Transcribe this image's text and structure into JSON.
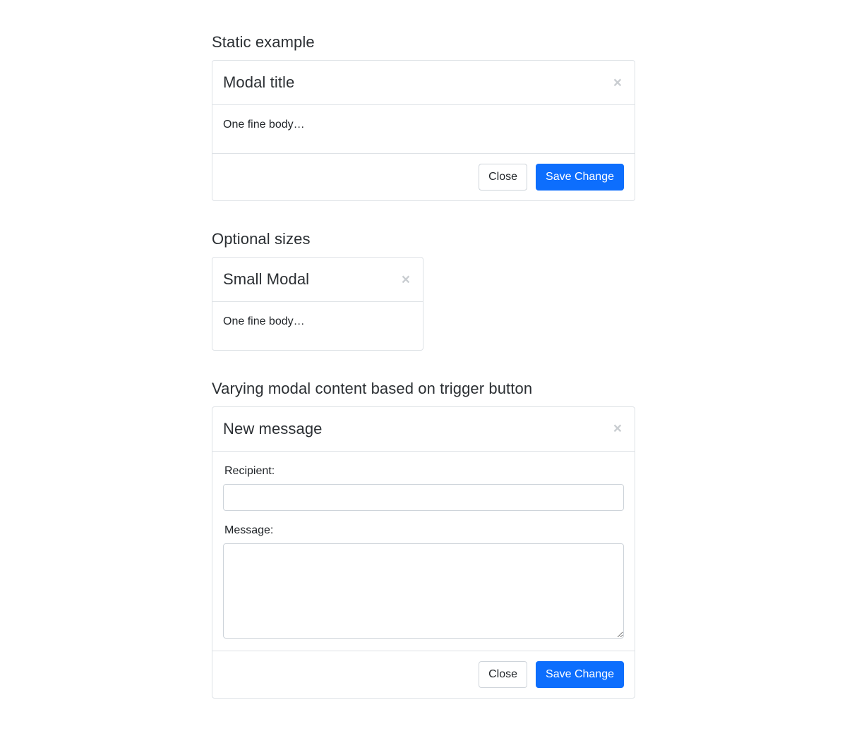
{
  "sections": [
    {
      "heading": "Static example",
      "modal": {
        "title": "Modal title",
        "close_icon_label": "×",
        "body_text": "One fine body…",
        "footer": {
          "close_label": "Close",
          "save_label": "Save Change"
        }
      }
    },
    {
      "heading": "Optional sizes",
      "modal": {
        "title": "Small Modal",
        "close_icon_label": "×",
        "body_text": "One fine body…"
      }
    },
    {
      "heading": "Varying modal content based on trigger button",
      "modal": {
        "title": "New message",
        "close_icon_label": "×",
        "form": {
          "recipient_label": "Recipient:",
          "recipient_value": "",
          "recipient_placeholder": "",
          "message_label": "Message:",
          "message_value": "",
          "message_placeholder": ""
        },
        "footer": {
          "close_label": "Close",
          "save_label": "Save Change"
        }
      }
    }
  ],
  "colors": {
    "primary": "#0d6efd",
    "border": "#dee2e6",
    "input_border": "#ced4da",
    "text": "#212529",
    "close_icon": "#c9cdd1",
    "background": "#ffffff"
  }
}
